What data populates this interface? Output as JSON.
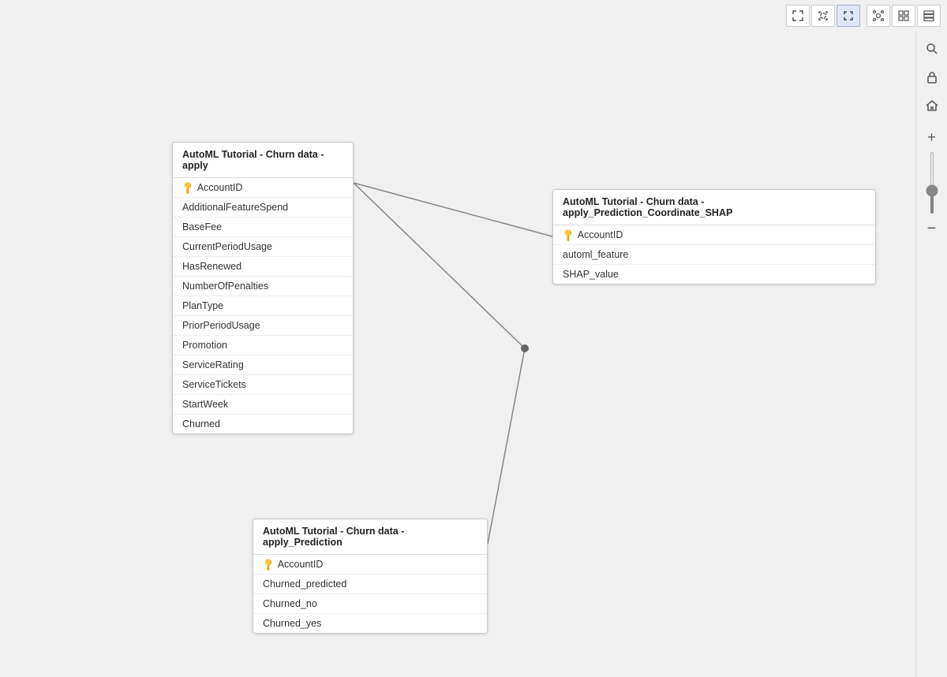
{
  "toolbar": {
    "buttons": [
      {
        "id": "shrink1",
        "label": "⤢",
        "title": "Fit to window"
      },
      {
        "id": "shrink2",
        "label": "⤡",
        "title": "Fit selection"
      },
      {
        "id": "expand",
        "label": "⤡",
        "title": "Expand"
      },
      {
        "id": "nodes",
        "label": "◉",
        "title": "Nodes view"
      },
      {
        "id": "grid",
        "label": "⊞",
        "title": "Grid view"
      },
      {
        "id": "list",
        "label": "⊟",
        "title": "List view"
      }
    ]
  },
  "sidebar": {
    "icons": [
      {
        "id": "search",
        "symbol": "🔍",
        "label": "Search"
      },
      {
        "id": "lock",
        "symbol": "🔒",
        "label": "Lock"
      },
      {
        "id": "home",
        "symbol": "🏠",
        "label": "Home"
      },
      {
        "id": "zoom-in",
        "symbol": "+",
        "label": "Zoom In"
      },
      {
        "id": "zoom-out",
        "symbol": "−",
        "label": "Zoom Out"
      }
    ],
    "zoom_value": 75
  },
  "nodes": {
    "apply": {
      "title": "AutoML Tutorial - Churn data - apply",
      "fields": [
        {
          "name": "AccountID",
          "is_key": true
        },
        {
          "name": "AdditionalFeatureSpend",
          "is_key": false
        },
        {
          "name": "BaseFee",
          "is_key": false
        },
        {
          "name": "CurrentPeriodUsage",
          "is_key": false
        },
        {
          "name": "HasRenewed",
          "is_key": false
        },
        {
          "name": "NumberOfPenalties",
          "is_key": false
        },
        {
          "name": "PlanType",
          "is_key": false
        },
        {
          "name": "PriorPeriodUsage",
          "is_key": false
        },
        {
          "name": "Promotion",
          "is_key": false
        },
        {
          "name": "ServiceRating",
          "is_key": false
        },
        {
          "name": "ServiceTickets",
          "is_key": false
        },
        {
          "name": "StartWeek",
          "is_key": false
        },
        {
          "name": "Churned",
          "is_key": false
        }
      ]
    },
    "shap": {
      "title": "AutoML Tutorial - Churn data - apply_Prediction_Coordinate_SHAP",
      "fields": [
        {
          "name": "AccountID",
          "is_key": true
        },
        {
          "name": "automl_feature",
          "is_key": false
        },
        {
          "name": "SHAP_value",
          "is_key": false
        }
      ]
    },
    "prediction": {
      "title": "AutoML Tutorial - Churn data - apply_Prediction",
      "fields": [
        {
          "name": "AccountID",
          "is_key": true
        },
        {
          "name": "Churned_predicted",
          "is_key": false
        },
        {
          "name": "Churned_no",
          "is_key": false
        },
        {
          "name": "Churned_yes",
          "is_key": false
        }
      ]
    }
  }
}
